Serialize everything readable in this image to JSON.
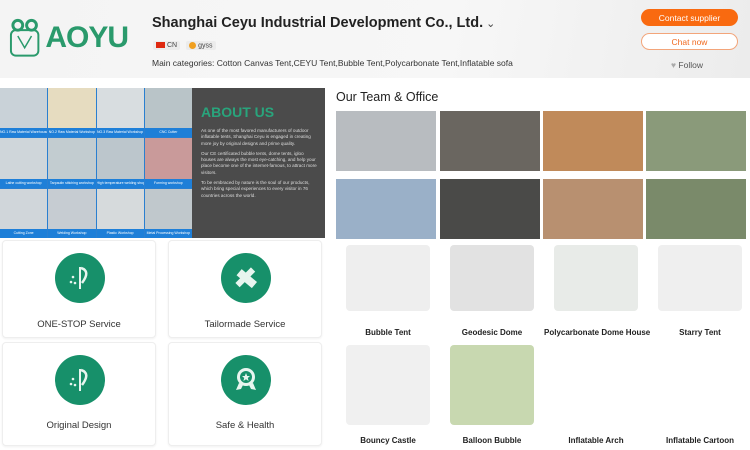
{
  "header": {
    "logo_text": "AOYU",
    "company": "Shanghai Ceyu Industrial Development Co., Ltd.",
    "country": "CN",
    "badge": "gyss",
    "main_categories": "Main categories: Cotton Canvas Tent,CEYU Tent,Bubble Tent,Polycarbonate Tent,Inflatable sofa",
    "contact_label": "Contact supplier",
    "chat_label": "Chat now",
    "follow_label": "Follow"
  },
  "colors": {
    "accent": "#f96a10",
    "brand_green": "#17906a",
    "about_bg": "#4b4b4b",
    "caption_blue": "#1e7fd8"
  },
  "about": {
    "title": "ABOUT US",
    "paragraphs": [
      "As one of the most favored manufacturers of outdoor inflatable tents, Shanghai Ceyu is engaged in creating more joy by original designs and prime quality.",
      "Our CE certificated bubble tents, dome tents, igloo houses are always the most eye-catching, and help your place become one of the internet-famous, to attract more visitors.",
      "To be embraced by nature is the soul of our products, which bring special experiences to every visitor in 76 countries across the world."
    ],
    "workshops": [
      "NO.1 Raw Material Warehouse",
      "NO.2 Raw Material Workshop",
      "NO.3 Raw Material Workshop",
      "CNC Cutter",
      "Lathe cutting workshop",
      "Tarpaulin stitching workshop",
      "High temperature welding shop",
      "Forming workshop",
      "Cutting Zone",
      "Welding Workshop",
      "Plastic Workshop",
      "Metal Processing Workshop"
    ]
  },
  "team": {
    "title": "Our Team & Office"
  },
  "services": [
    {
      "label": "ONE-STOP Service",
      "icon": "pen-nib-icon"
    },
    {
      "label": "Tailormade Service",
      "icon": "pencil-ruler-icon"
    },
    {
      "label": "Original Design",
      "icon": "pen-nib-icon"
    },
    {
      "label": "Safe & Health",
      "icon": "award-medal-icon"
    }
  ],
  "products": [
    {
      "label": "Bubble Tent"
    },
    {
      "label": "Geodesic Dome"
    },
    {
      "label": "Polycarbonate Dome House"
    },
    {
      "label": "Starry Tent"
    },
    {
      "label": "Bouncy Castle"
    },
    {
      "label": "Balloon Bubble"
    },
    {
      "label": "Inflatable Arch"
    },
    {
      "label": "Inflatable Cartoon"
    }
  ]
}
